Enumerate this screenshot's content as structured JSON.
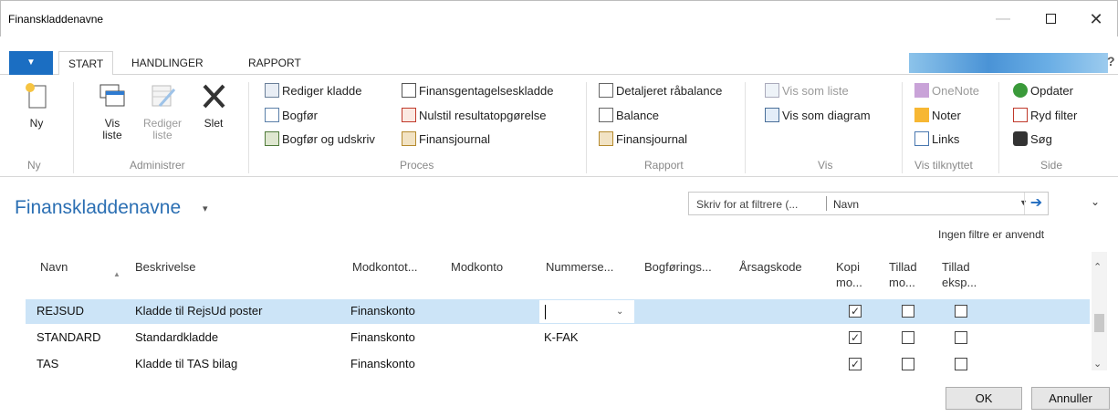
{
  "window": {
    "title": "Finanskladdenavne",
    "minimize": "—",
    "close": "✕"
  },
  "tabs": [
    {
      "label": "START"
    },
    {
      "label": "HANDLINGER"
    },
    {
      "label": "RAPPORT"
    }
  ],
  "ribbon": {
    "ny": {
      "label": "Ny",
      "group": "Ny"
    },
    "administrer": {
      "group": "Administrer",
      "vis_liste": [
        "Vis",
        "liste"
      ],
      "rediger_liste": [
        "Rediger",
        "liste"
      ],
      "slet": "Slet"
    },
    "proces": {
      "group": "Proces",
      "rediger_kladde": "Rediger kladde",
      "bogfor": "Bogfør",
      "bogfor_udskriv": "Bogfør og udskriv",
      "finansgentagelseskladde": "Finansgentagelseskladde",
      "nulstil": "Nulstil resultatopgørelse",
      "finansjournal": "Finansjournal"
    },
    "rapport": {
      "group": "Rapport",
      "detaljeret": "Detaljeret råbalance",
      "balance": "Balance",
      "finansjournal": "Finansjournal"
    },
    "vis": {
      "group": "Vis",
      "vis_som_liste": "Vis som liste",
      "vis_som_diagram": "Vis som diagram"
    },
    "vis_tilknyttet": {
      "group": "Vis tilknyttet",
      "onenote": "OneNote",
      "noter": "Noter",
      "links": "Links"
    },
    "side": {
      "group": "Side",
      "opdater": "Opdater",
      "ryd_filter": "Ryd filter",
      "sog": "Søg"
    }
  },
  "page": {
    "title": "Finanskladdenavne",
    "filter_placeholder": "Skriv for at filtrere (...",
    "filter_field": "Navn",
    "no_filters": "Ingen filtre er anvendt"
  },
  "table": {
    "headers": [
      [
        "Navn"
      ],
      [
        "Beskrivelse"
      ],
      [
        "Modkontot..."
      ],
      [
        "Modkonto"
      ],
      [
        "Nummerse..."
      ],
      [
        "Bogførings..."
      ],
      [
        "Årsagskode"
      ],
      [
        "Kopi",
        "mo..."
      ],
      [
        "Tillad",
        "mo..."
      ],
      [
        "Tillad",
        "eksp..."
      ]
    ],
    "rows": [
      {
        "navn": "REJSUD",
        "beskrivelse": "Kladde til RejsUd poster",
        "modkontotype": "Finanskonto",
        "nummerserie": "",
        "kopi": true,
        "tillad_mo": false,
        "tillad_eksp": false
      },
      {
        "navn": "STANDARD",
        "beskrivelse": "Standardkladde",
        "modkontotype": "Finanskonto",
        "nummerserie": "K-FAK",
        "kopi": true,
        "tillad_mo": false,
        "tillad_eksp": false
      },
      {
        "navn": "TAS",
        "beskrivelse": "Kladde til TAS bilag",
        "modkontotype": "Finanskonto",
        "nummerserie": "",
        "kopi": true,
        "tillad_mo": false,
        "tillad_eksp": false
      }
    ]
  },
  "buttons": {
    "ok": "OK",
    "cancel": "Annuller"
  }
}
